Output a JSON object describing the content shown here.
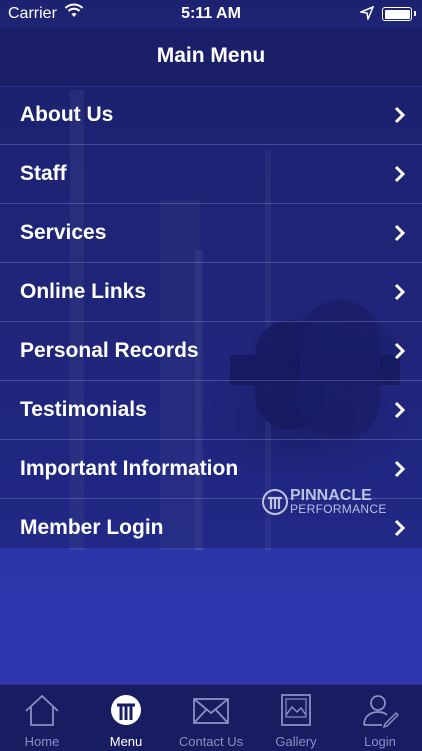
{
  "status_bar": {
    "carrier": "Carrier",
    "time": "5:11 AM"
  },
  "nav": {
    "title": "Main Menu"
  },
  "menu_items": [
    {
      "label": "About Us"
    },
    {
      "label": "Staff"
    },
    {
      "label": "Services"
    },
    {
      "label": "Online Links"
    },
    {
      "label": "Personal Records"
    },
    {
      "label": "Testimonials"
    },
    {
      "label": "Important Information"
    },
    {
      "label": "Member Login"
    }
  ],
  "logo": {
    "name": "PINNACLE",
    "sub": "PERFORMANCE"
  },
  "tabs": [
    {
      "label": "Home",
      "icon": "home-icon",
      "active": false
    },
    {
      "label": "Menu",
      "icon": "pinnacle-logo-icon",
      "active": true
    },
    {
      "label": "Contact Us",
      "icon": "envelope-icon",
      "active": false
    },
    {
      "label": "Gallery",
      "icon": "picture-icon",
      "active": false
    },
    {
      "label": "Login",
      "icon": "user-edit-icon",
      "active": false
    }
  ],
  "colors": {
    "nav_bg": "#1b1f6a",
    "tab_bg": "#181c60",
    "inactive_tab": "#8a8fc4"
  }
}
